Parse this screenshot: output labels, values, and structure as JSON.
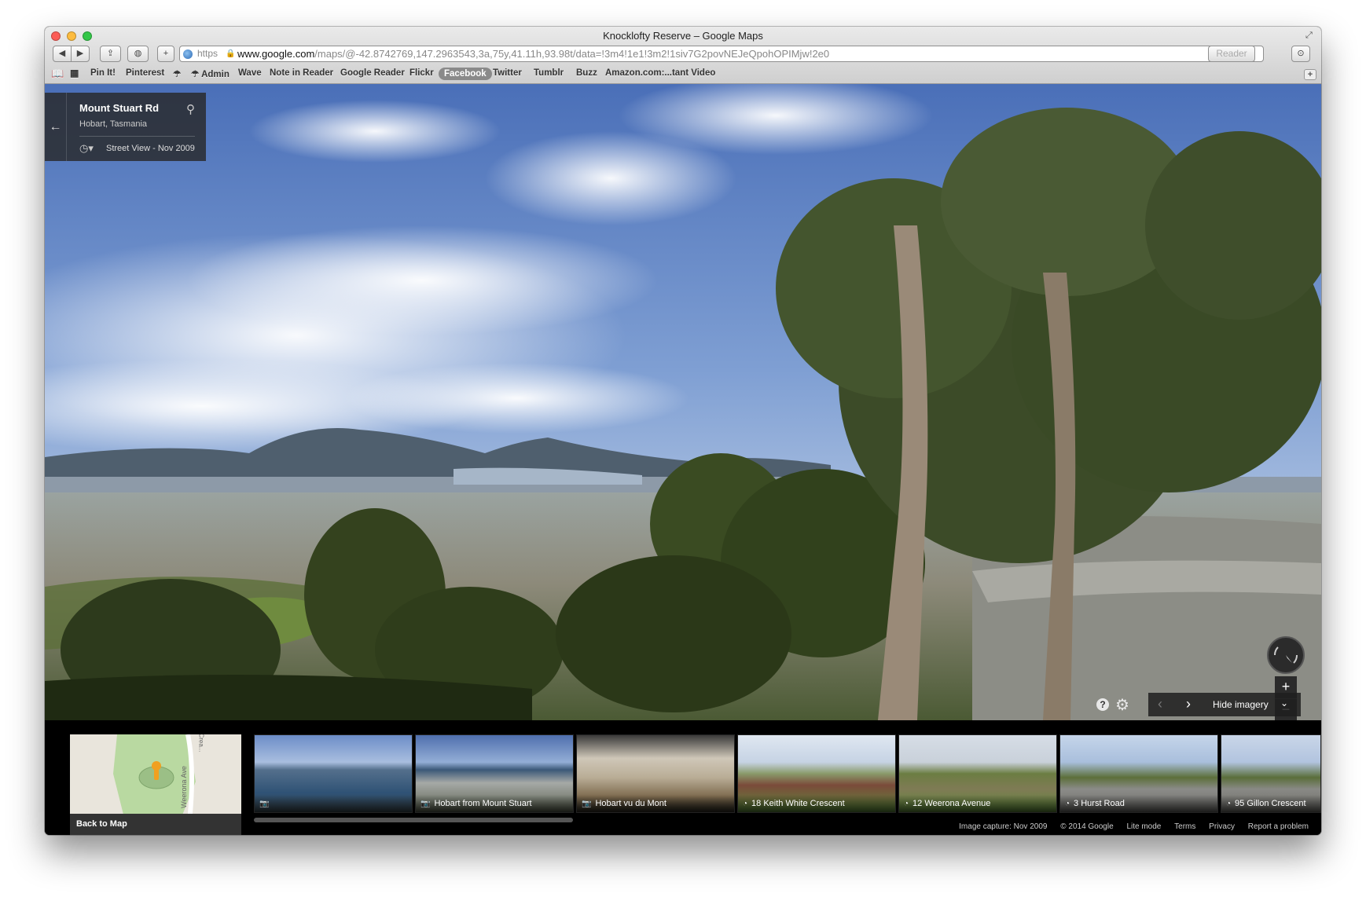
{
  "window": {
    "title": "Knocklofty Reserve – Google Maps"
  },
  "toolbar": {
    "back": "◀",
    "forward": "▶",
    "share": "⇪",
    "ghost": "◍",
    "add": "+",
    "scheme": "https",
    "url_host": "www.google.com",
    "url_path": "/maps/@-42.8742769,147.2963543,3a,75y,41.11h,93.98t/data=!3m4!1e1!3m2!1siv7G2povNEJeQpohOPIMjw!2e0",
    "reader": "Reader",
    "reload": "↻",
    "downloads": "⊙"
  },
  "bookmarks": [
    {
      "label": "Pin It!"
    },
    {
      "label": "Pinterest"
    },
    {
      "label": "☂"
    },
    {
      "label": "☂ Admin"
    },
    {
      "label": "Wave"
    },
    {
      "label": "Note in Reader"
    },
    {
      "label": "Google Reader"
    },
    {
      "label": "Flickr"
    },
    {
      "label": "Facebook"
    },
    {
      "label": "Twitter"
    },
    {
      "label": "Tumblr"
    },
    {
      "label": "Buzz"
    },
    {
      "label": "Amazon.com:...tant Video"
    }
  ],
  "info_card": {
    "title": "Mount Stuart Rd",
    "subtitle": "Hobart, Tasmania",
    "date": "Street View - Nov 2009"
  },
  "controls": {
    "zoom_in": "+",
    "zoom_out": "−",
    "help": "?",
    "hide_imagery": "Hide imagery"
  },
  "filmstrip": {
    "back_to_map": "Back to Map",
    "minimap_streets": [
      "Crea...",
      "Weerona Ave"
    ],
    "thumbnails": [
      {
        "caption": "",
        "kind": "photo"
      },
      {
        "caption": "Hobart from Mount Stuart",
        "kind": "photo"
      },
      {
        "caption": "Hobart vu du Mont",
        "kind": "photo"
      },
      {
        "caption": "18 Keith White Crescent",
        "kind": "streetview"
      },
      {
        "caption": "12 Weerona Avenue",
        "kind": "streetview"
      },
      {
        "caption": "3 Hurst Road",
        "kind": "streetview"
      },
      {
        "caption": "95 Gillon Crescent",
        "kind": "streetview"
      }
    ]
  },
  "footer": {
    "capture": "Image capture: Nov 2009",
    "copyright": "© 2014 Google",
    "lite": "Lite mode",
    "terms": "Terms",
    "privacy": "Privacy",
    "report": "Report a problem"
  }
}
